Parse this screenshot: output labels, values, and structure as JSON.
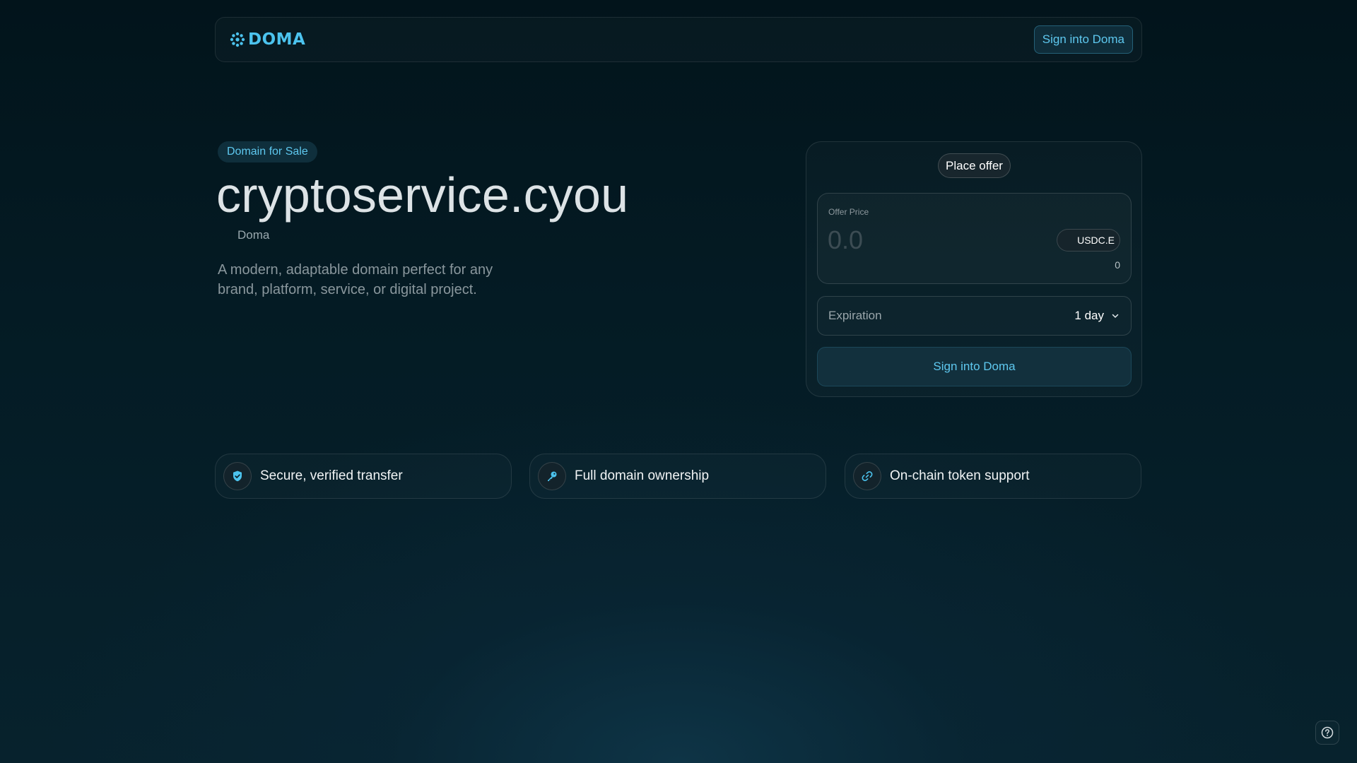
{
  "header": {
    "logo_text": "DOMA",
    "signin_label": "Sign into Doma"
  },
  "hero": {
    "badge": "Domain for Sale",
    "domain": "cryptoservice.cyou",
    "registrar": "Doma",
    "description": "A modern, adaptable domain perfect for any brand, platform, service, or digital project."
  },
  "offer": {
    "tab_label": "Place offer",
    "price_label": "Offer Price",
    "price_placeholder": "0.0",
    "currency": "USDC.E",
    "balance": "0",
    "expiration_label": "Expiration",
    "expiration_value": "1 day",
    "submit_label": "Sign into Doma"
  },
  "features": [
    {
      "icon": "shield-check-icon",
      "label": "Secure, verified transfer"
    },
    {
      "icon": "key-icon",
      "label": "Full domain ownership"
    },
    {
      "icon": "link-icon",
      "label": "On-chain token support"
    }
  ],
  "help": {
    "icon": "help-icon"
  },
  "colors": {
    "accent": "#4cc3ee",
    "background": "#041b24"
  }
}
